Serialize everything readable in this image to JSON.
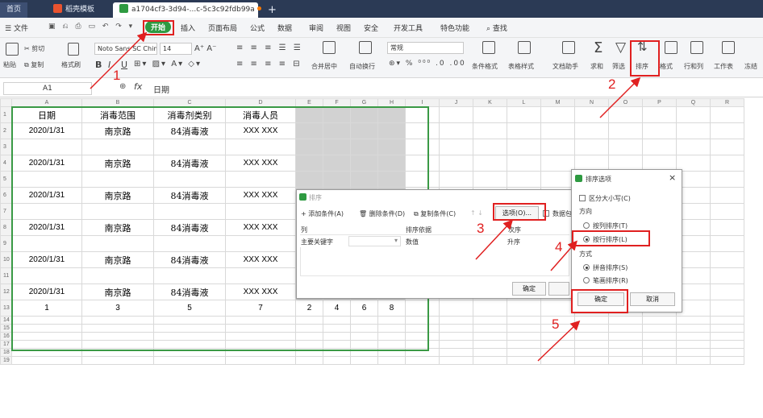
{
  "tabs": {
    "home": "首页",
    "template": "稻壳模板",
    "file": "a1704cf3-3d94-...c-5c3c92fdb99a",
    "new": "+"
  },
  "menu": {
    "file": "文件",
    "start": "开始",
    "insert": "插入",
    "page_layout": "页面布局",
    "formula": "公式",
    "data": "数据",
    "review": "审阅",
    "view": "视图",
    "security": "安全",
    "dev": "开发工具",
    "special": "特色功能",
    "search": "查找"
  },
  "ribbon": {
    "paste": "粘贴",
    "cut": "剪切",
    "copy": "复制",
    "format_painter": "格式刷",
    "font": "Noto Sans SC Chine",
    "size": "14",
    "bold": "B",
    "italic": "I",
    "underline": "U",
    "merge": "合并居中",
    "wrap": "自动换行",
    "number_format": "常规",
    "cond_format": "条件格式",
    "table_style": "表格样式",
    "doc_helper": "文档助手",
    "sum": "求和",
    "filter": "筛选",
    "sort": "排序",
    "format": "格式",
    "rowcol": "行和列",
    "worksheet": "工作表",
    "freeze": "冻结"
  },
  "formula_bar": {
    "cell_ref": "A1",
    "fx": "fx",
    "content": "日期"
  },
  "columns": [
    "A",
    "B",
    "C",
    "D",
    "E",
    "F",
    "G",
    "H",
    "I",
    "J",
    "K",
    "L",
    "M",
    "N",
    "O",
    "P",
    "Q",
    "R"
  ],
  "rows": [
    {
      "n": "1",
      "a": "日期",
      "b": "消毒范围",
      "c": "消毒剂类别",
      "d": "消毒人员",
      "e": "",
      "f": "",
      "g": "",
      "h": ""
    },
    {
      "n": "2",
      "a": "2020/1/31",
      "b": "南京路",
      "c": "84消毒液",
      "d": "XXX XXX",
      "e": "",
      "f": "",
      "g": "",
      "h": ""
    },
    {
      "n": "3",
      "a": "",
      "b": "",
      "c": "",
      "d": "",
      "e": "",
      "f": "",
      "g": "",
      "h": ""
    },
    {
      "n": "4",
      "a": "2020/1/31",
      "b": "南京路",
      "c": "84消毒液",
      "d": "XXX XXX",
      "e": "",
      "f": "",
      "g": "",
      "h": ""
    },
    {
      "n": "5",
      "a": "",
      "b": "",
      "c": "",
      "d": "",
      "e": "",
      "f": "",
      "g": "",
      "h": ""
    },
    {
      "n": "6",
      "a": "2020/1/31",
      "b": "南京路",
      "c": "84消毒液",
      "d": "XXX XXX",
      "e": "",
      "f": "",
      "g": "",
      "h": ""
    },
    {
      "n": "7",
      "a": "",
      "b": "",
      "c": "",
      "d": "",
      "e": "",
      "f": "",
      "g": "",
      "h": ""
    },
    {
      "n": "8",
      "a": "2020/1/31",
      "b": "南京路",
      "c": "84消毒液",
      "d": "XXX XXX",
      "e": "",
      "f": "",
      "g": "",
      "h": ""
    },
    {
      "n": "9",
      "a": "",
      "b": "",
      "c": "",
      "d": "",
      "e": "",
      "f": "",
      "g": "",
      "h": ""
    },
    {
      "n": "10",
      "a": "2020/1/31",
      "b": "南京路",
      "c": "84消毒液",
      "d": "XXX XXX",
      "e": "",
      "f": "",
      "g": "",
      "h": ""
    },
    {
      "n": "11",
      "a": "",
      "b": "",
      "c": "",
      "d": "",
      "e": "",
      "f": "",
      "g": "",
      "h": ""
    },
    {
      "n": "12",
      "a": "2020/1/31",
      "b": "南京路",
      "c": "84消毒液",
      "d": "XXX XXX",
      "e": "",
      "f": "",
      "g": "",
      "h": ""
    },
    {
      "n": "13",
      "a": "1",
      "b": "3",
      "c": "5",
      "d": "7",
      "e": "2",
      "f": "4",
      "g": "6",
      "h": "8"
    }
  ],
  "empty_rows": [
    "14",
    "15",
    "16",
    "17",
    "18",
    "19"
  ],
  "sort_dialog": {
    "title": "排序",
    "add": "添加条件(A)",
    "delete": "删除条件(D)",
    "copy": "复制条件(C)",
    "options": "选项(O)...",
    "data_header": "数据包",
    "col_header": "列",
    "basis_header": "排序依据",
    "order_header": "次序",
    "key_label": "主要关键字",
    "basis_value": "数值",
    "order_value": "升序",
    "ok": "确定"
  },
  "options_dialog": {
    "title": "排序选项",
    "case": "区分大小写(C)",
    "direction": "方向",
    "by_col": "按列排序(T)",
    "by_row": "按行排序(L)",
    "method": "方式",
    "pinyin": "拼音排序(S)",
    "stroke": "笔画排序(R)",
    "ok": "确定",
    "cancel": "取消",
    "close": "×"
  },
  "annotations": {
    "n1": "1",
    "n2": "2",
    "n3": "3",
    "n4": "4",
    "n5": "5"
  },
  "colors": {
    "accent": "#2e9a41",
    "annotation_red": "#e02020",
    "tab_bar": "#2b3a55"
  }
}
